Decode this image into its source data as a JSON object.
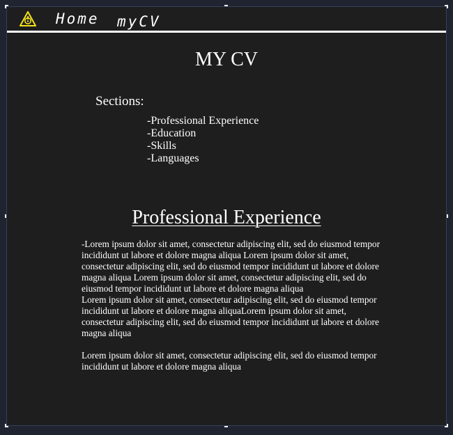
{
  "nav": {
    "logo_icon": "warning-triangle-icon",
    "home_label": "Home",
    "mycv_label": "myCV"
  },
  "colors": {
    "page_background": "#1e1e1e",
    "text": "#ffffff",
    "logo": "#f5e11c"
  },
  "page": {
    "title": "MY CV"
  },
  "sections": {
    "label": "Sections:",
    "items": [
      "-Professional Experience",
      "-Education",
      "-Skills",
      "-Languages"
    ]
  },
  "experience": {
    "heading": "Professional Experience",
    "paragraphs": [
      "-Lorem ipsum dolor sit amet, consectetur adipiscing elit, sed do eiusmod tempor incididunt ut labore et dolore magna aliqua Lorem ipsum dolor sit amet, consectetur adipiscing elit, sed do eiusmod tempor incididunt ut labore et dolore magna aliqua Lorem ipsum dolor sit amet, consectetur adipiscing elit, sed do eiusmod tempor incididunt ut labore et dolore magna aliqua",
      "Lorem ipsum dolor sit amet, consectetur adipiscing elit, sed do eiusmod tempor incididunt ut labore et dolore magna aliquaLorem ipsum dolor sit amet, consectetur adipiscing elit, sed do eiusmod tempor incididunt ut labore et dolore magna aliqua",
      "Lorem ipsum dolor sit amet, consectetur adipiscing elit, sed do eiusmod tempor incididunt ut labore et dolore magna aliqua"
    ]
  }
}
